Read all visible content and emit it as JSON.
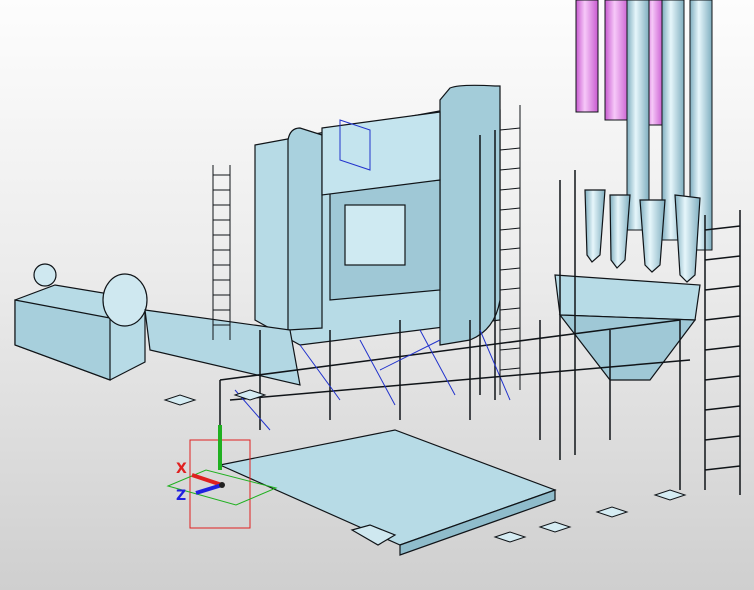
{
  "viewport": {
    "type": "3d-cad-model-view",
    "subject": "industrial-plant-structure",
    "background": "light-gray-gradient"
  },
  "colors": {
    "model_fill": "#b7dbe6",
    "model_fill_dark": "#8fbccb",
    "model_edge": "#101418",
    "hidden_lines": "#2233cc",
    "pipe_highlight": "#e07ae6",
    "axis_x": "#e02020",
    "axis_y": "#20b020",
    "axis_z": "#2020e0"
  },
  "triad": {
    "x_label": "X",
    "z_label": "Z",
    "y_label": ""
  }
}
